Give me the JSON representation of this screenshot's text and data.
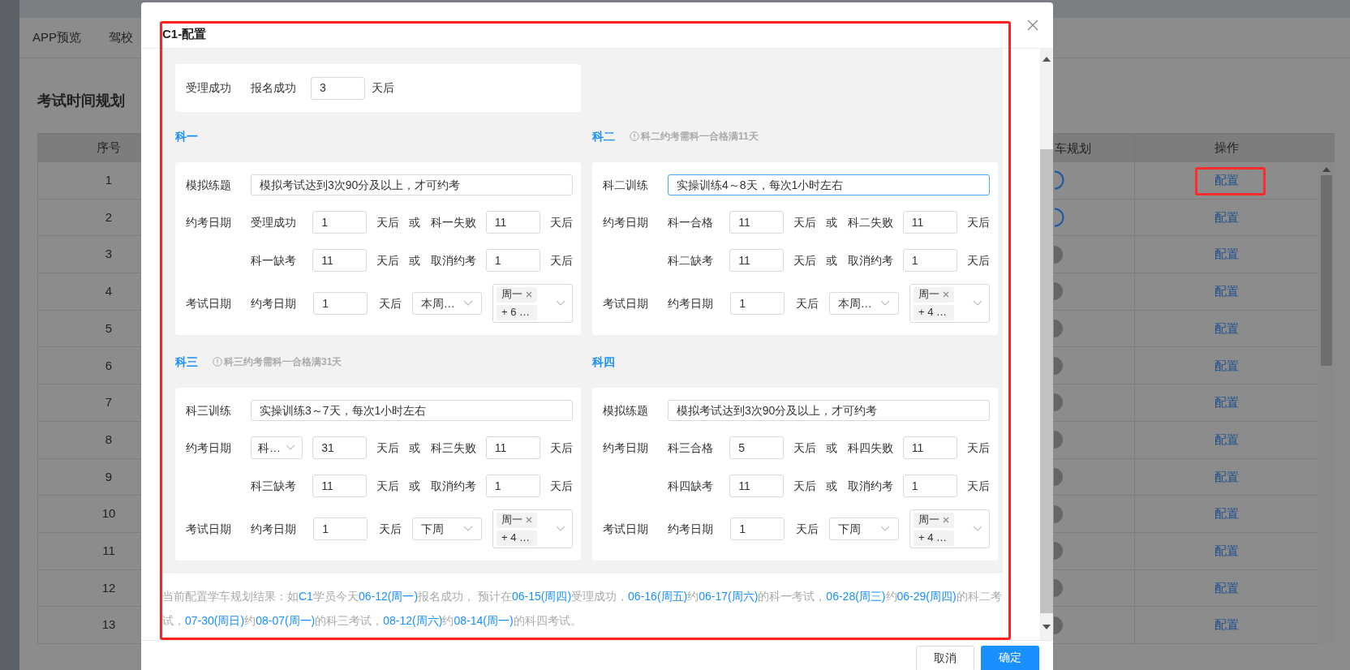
{
  "page": {
    "tabs": [
      "APP预览",
      "驾校"
    ],
    "title": "考试时间规划",
    "columns": [
      "序号",
      "车规划",
      "操作"
    ],
    "rows": [
      {
        "index": "1",
        "plan_on": true,
        "action": "配置",
        "marked": true
      },
      {
        "index": "2",
        "plan_on": true,
        "action": "配置",
        "marked": false
      },
      {
        "index": "3",
        "plan_on": false,
        "action": "配置",
        "marked": false
      },
      {
        "index": "4",
        "plan_on": false,
        "action": "配置",
        "marked": false
      },
      {
        "index": "5",
        "plan_on": false,
        "action": "配置",
        "marked": false
      },
      {
        "index": "6",
        "plan_on": false,
        "action": "配置",
        "marked": false
      },
      {
        "index": "7",
        "plan_on": false,
        "action": "配置",
        "marked": false
      },
      {
        "index": "8",
        "plan_on": false,
        "action": "配置",
        "marked": false
      },
      {
        "index": "9",
        "plan_on": false,
        "action": "配置",
        "marked": false
      },
      {
        "index": "10",
        "plan_on": false,
        "action": "配置",
        "marked": false
      },
      {
        "index": "11",
        "plan_on": false,
        "action": "配置",
        "marked": false
      },
      {
        "index": "12",
        "plan_on": false,
        "action": "配置",
        "marked": false
      },
      {
        "index": "13",
        "plan_on": false,
        "action": "配置",
        "marked": false
      }
    ]
  },
  "dialog": {
    "title": "C1-配置",
    "marked": true,
    "accept": {
      "label": "受理成功",
      "cond": "报名成功",
      "value": "3",
      "unit": "天后"
    },
    "subjects": [
      {
        "title": "科一",
        "practice": {
          "label": "模拟练题",
          "value": "模拟考试达到3次90分及以上，才可约考",
          "focused": false
        },
        "booking": {
          "label": "约考日期",
          "rows": [
            {
              "kind": "label",
              "cond": "受理成功",
              "value": "1",
              "unit": "天后",
              "or": "或",
              "alt": "科一失败",
              "alt_value": "11",
              "alt_unit": "天后"
            },
            {
              "kind": "label",
              "cond": "科一缺考",
              "value": "11",
              "unit": "天后",
              "or": "或",
              "alt": "取消约考",
              "alt_value": "1",
              "alt_unit": "天后"
            }
          ]
        },
        "exam": {
          "label": "考试日期",
          "cond": "约考日期",
          "value": "1",
          "unit": "天后",
          "week": "本周…",
          "days": [
            "周一"
          ],
          "more": "+ 6 …"
        }
      },
      {
        "title": "科二",
        "note": "科二约考需科一合格满11天",
        "practice": {
          "label": "科二训练",
          "value": "实操训练4～8天，每次1小时左右",
          "focused": true
        },
        "booking": {
          "label": "约考日期",
          "rows": [
            {
              "kind": "label",
              "cond": "科一合格",
              "value": "11",
              "unit": "天后",
              "or": "或",
              "alt": "科二失败",
              "alt_value": "11",
              "alt_unit": "天后"
            },
            {
              "kind": "label",
              "cond": "科二缺考",
              "value": "11",
              "unit": "天后",
              "or": "或",
              "alt": "取消约考",
              "alt_value": "1",
              "alt_unit": "天后"
            }
          ]
        },
        "exam": {
          "label": "考试日期",
          "cond": "约考日期",
          "value": "1",
          "unit": "天后",
          "week": "本周…",
          "days": [
            "周一"
          ],
          "more": "+ 4 …"
        }
      },
      {
        "title": "科三",
        "note": "科三约考需科一合格满31天",
        "practice": {
          "label": "科三训练",
          "value": "实操训练3～7天，每次1小时左右",
          "focused": false
        },
        "booking": {
          "label": "约考日期",
          "rows": [
            {
              "kind": "select",
              "cond": "科…",
              "value": "31",
              "unit": "天后",
              "or": "或",
              "alt": "科三失败",
              "alt_value": "11",
              "alt_unit": "天后"
            },
            {
              "kind": "label",
              "cond": "科三缺考",
              "value": "11",
              "unit": "天后",
              "or": "或",
              "alt": "取消约考",
              "alt_value": "1",
              "alt_unit": "天后"
            }
          ]
        },
        "exam": {
          "label": "考试日期",
          "cond": "约考日期",
          "value": "1",
          "unit": "天后",
          "week": "下周",
          "days": [
            "周一"
          ],
          "more": "+ 4 …"
        }
      },
      {
        "title": "科四",
        "practice": {
          "label": "模拟练题",
          "value": "模拟考试达到3次90分及以上，才可约考",
          "focused": false
        },
        "booking": {
          "label": "约考日期",
          "rows": [
            {
              "kind": "label",
              "cond": "科三合格",
              "value": "5",
              "unit": "天后",
              "or": "或",
              "alt": "科四失败",
              "alt_value": "11",
              "alt_unit": "天后"
            },
            {
              "kind": "label",
              "cond": "科四缺考",
              "value": "11",
              "unit": "天后",
              "or": "或",
              "alt": "取消约考",
              "alt_value": "1",
              "alt_unit": "天后"
            }
          ]
        },
        "exam": {
          "label": "考试日期",
          "cond": "约考日期",
          "value": "1",
          "unit": "天后",
          "week": "下周",
          "days": [
            "周一"
          ],
          "more": "+ 4 …"
        }
      }
    ],
    "result": [
      {
        "text": "当前配置学车规划结果：如",
        "highlight": false
      },
      {
        "text": "C1",
        "highlight": true
      },
      {
        "text": "学员今天",
        "highlight": false
      },
      {
        "text": "06-12(周一)",
        "highlight": true
      },
      {
        "text": "报名成功， 预计在",
        "highlight": false
      },
      {
        "text": "06-15(周四)",
        "highlight": true
      },
      {
        "text": "受理成功，",
        "highlight": false
      },
      {
        "text": "06-16(周五)",
        "highlight": true
      },
      {
        "text": "约",
        "highlight": false
      },
      {
        "text": "06-17(周六)",
        "highlight": true
      },
      {
        "text": "的科一考试，",
        "highlight": false
      },
      {
        "text": "06-28(周三)",
        "highlight": true
      },
      {
        "text": "约",
        "highlight": false
      },
      {
        "text": "06-29(周四)",
        "highlight": true
      },
      {
        "text": "的科二考试，",
        "highlight": false
      },
      {
        "text": "07-30(周日)",
        "highlight": true
      },
      {
        "text": "约",
        "highlight": false
      },
      {
        "text": "08-07(周一)",
        "highlight": true
      },
      {
        "text": "的科三考试，",
        "highlight": false
      },
      {
        "text": "08-12(周六)",
        "highlight": true
      },
      {
        "text": "约",
        "highlight": false
      },
      {
        "text": "08-14(周一)",
        "highlight": true
      },
      {
        "text": "的科四考试。",
        "highlight": false
      }
    ],
    "buttons": [
      {
        "label": "取消",
        "kind": "default"
      },
      {
        "label": "确定",
        "kind": "primary"
      }
    ]
  }
}
